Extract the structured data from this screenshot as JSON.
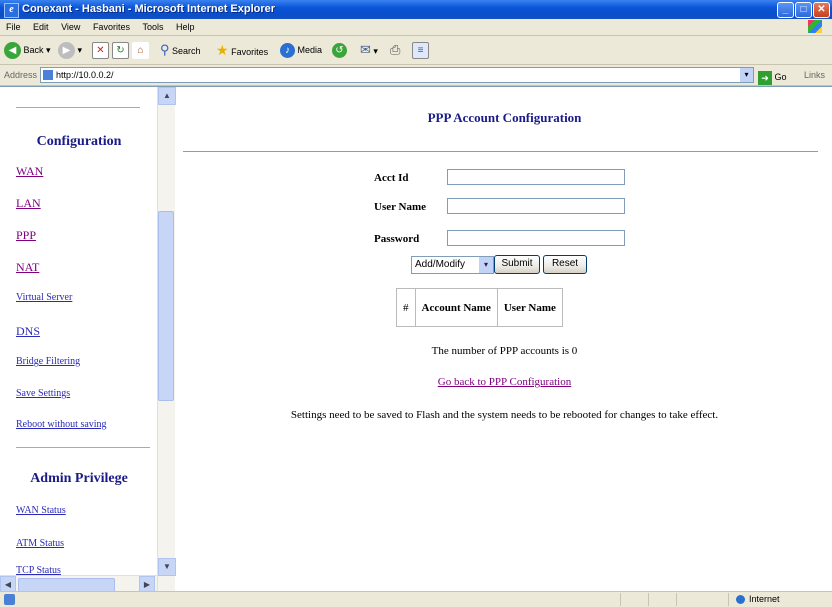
{
  "window": {
    "title": "Conexant - Hasbani - Microsoft Internet Explorer"
  },
  "menu": [
    "File",
    "Edit",
    "View",
    "Favorites",
    "Tools",
    "Help"
  ],
  "toolbar": {
    "back": "Back",
    "search": "Search",
    "favorites": "Favorites",
    "media": "Media"
  },
  "address": {
    "label": "Address",
    "url": "http://10.0.0.2/",
    "go": "Go",
    "links": "Links"
  },
  "sidebar": {
    "config_heading": "Configuration",
    "config_links": [
      "WAN",
      "LAN",
      "PPP",
      "NAT",
      "Virtual Server",
      "DNS",
      "Bridge Filtering",
      "Save Settings",
      "Reboot without saving"
    ],
    "admin_heading": "Admin Privilege",
    "admin_links": [
      "WAN Status",
      "ATM Status",
      "TCP Status"
    ]
  },
  "main": {
    "title": "PPP Account Configuration",
    "fields": {
      "acct_id": "Acct Id",
      "user_name": "User Name",
      "password": "Password"
    },
    "action_select": "Add/Modify",
    "submit": "Submit",
    "reset": "Reset",
    "table_headers": [
      "#",
      "Account Name",
      "User Name"
    ],
    "count_text": "The number of PPP accounts is 0",
    "back_link": "Go back to PPP Configuration",
    "note": "Settings need to be saved to Flash and the system needs to be rebooted for changes to take effect."
  },
  "status": {
    "zone": "Internet"
  },
  "colors": {
    "heading": "#1a1a88",
    "link": "#2a2ab8",
    "visited": "#800080"
  }
}
